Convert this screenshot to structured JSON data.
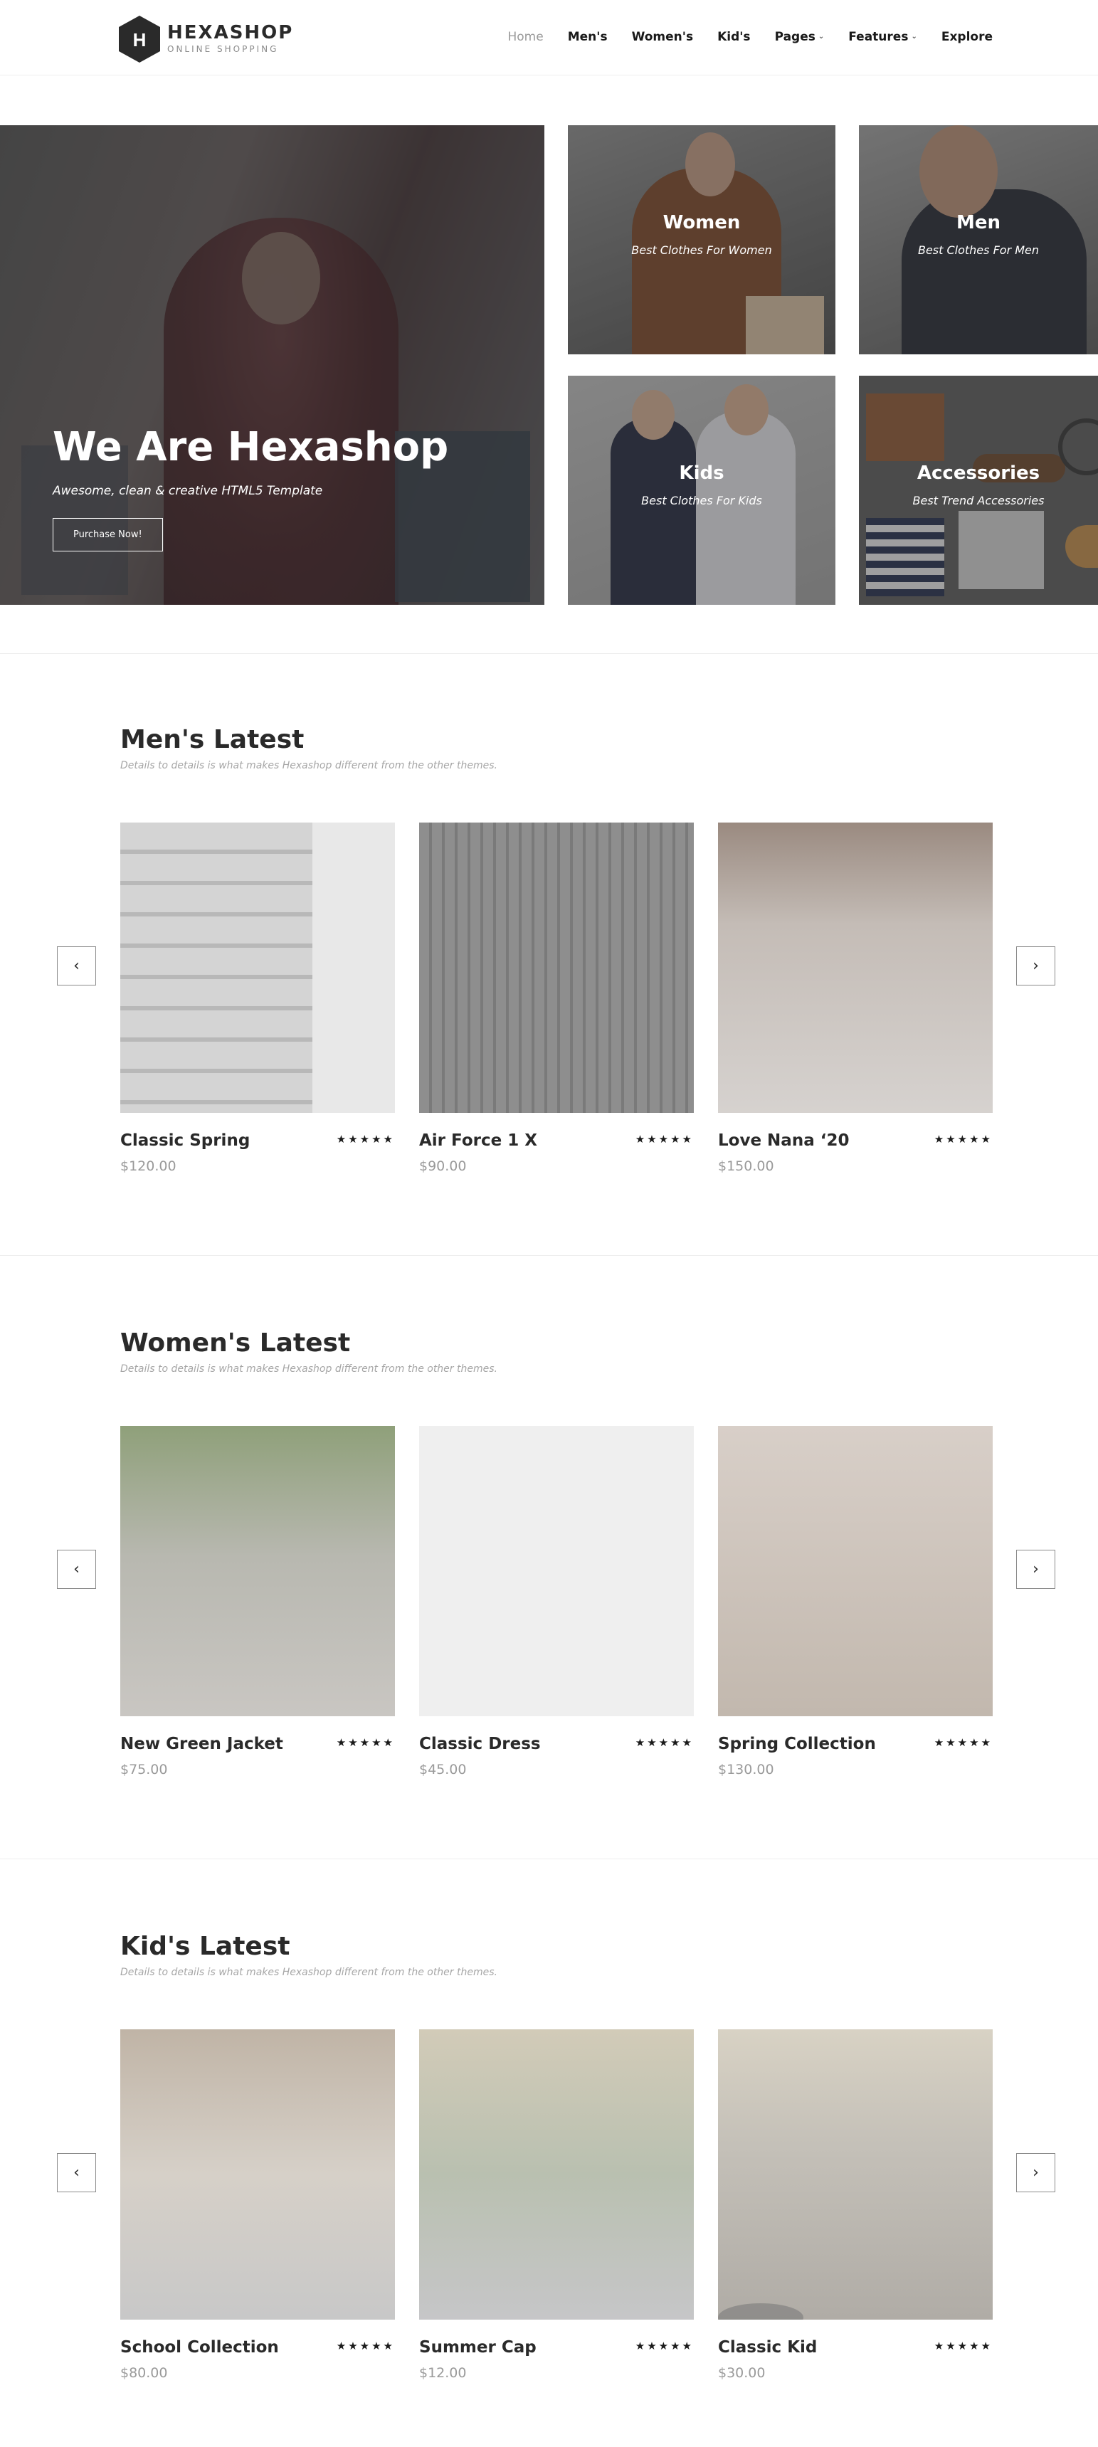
{
  "header": {
    "logo_letter": "H",
    "brand": "HEXASHOP",
    "tagline": "ONLINE SHOPPING",
    "nav": [
      {
        "label": "Home"
      },
      {
        "label": "Men's"
      },
      {
        "label": "Women's"
      },
      {
        "label": "Kid's"
      },
      {
        "label": "Pages"
      },
      {
        "label": "Features"
      },
      {
        "label": "Explore"
      }
    ]
  },
  "hero": {
    "title": "We Are Hexashop",
    "subtitle": "Awesome, clean & creative HTML5 Template",
    "button": "Purchase Now!"
  },
  "categories": [
    {
      "title": "Women",
      "subtitle": "Best Clothes For Women"
    },
    {
      "title": "Men",
      "subtitle": "Best Clothes For Men"
    },
    {
      "title": "Kids",
      "subtitle": "Best Clothes For Kids"
    },
    {
      "title": "Accessories",
      "subtitle": "Best Trend Accessories"
    }
  ],
  "sections": [
    {
      "title": "Men's Latest",
      "subtitle": "Details to details is what makes Hexashop different from the other themes.",
      "products": [
        {
          "name": "Classic Spring",
          "price": "$120.00",
          "rating": "★★★★★"
        },
        {
          "name": "Air Force 1 X",
          "price": "$90.00",
          "rating": "★★★★★"
        },
        {
          "name": "Love Nana ‘20",
          "price": "$150.00",
          "rating": "★★★★★"
        }
      ]
    },
    {
      "title": "Women's Latest",
      "subtitle": "Details to details is what makes Hexashop different from the other themes.",
      "products": [
        {
          "name": "New Green Jacket",
          "price": "$75.00",
          "rating": "★★★★★"
        },
        {
          "name": "Classic Dress",
          "price": "$45.00",
          "rating": "★★★★★"
        },
        {
          "name": "Spring Collection",
          "price": "$130.00",
          "rating": "★★★★★"
        }
      ]
    },
    {
      "title": "Kid's Latest",
      "subtitle": "Details to details is what makes Hexashop different from the other themes.",
      "products": [
        {
          "name": "School Collection",
          "price": "$80.00",
          "rating": "★★★★★"
        },
        {
          "name": "Summer Cap",
          "price": "$12.00",
          "rating": "★★★★★"
        },
        {
          "name": "Classic Kid",
          "price": "$30.00",
          "rating": "★★★★★"
        }
      ]
    }
  ],
  "icons": {
    "prev": "chevron-left-icon",
    "next": "chevron-right-icon",
    "dropdown": "chevron-down-icon"
  }
}
